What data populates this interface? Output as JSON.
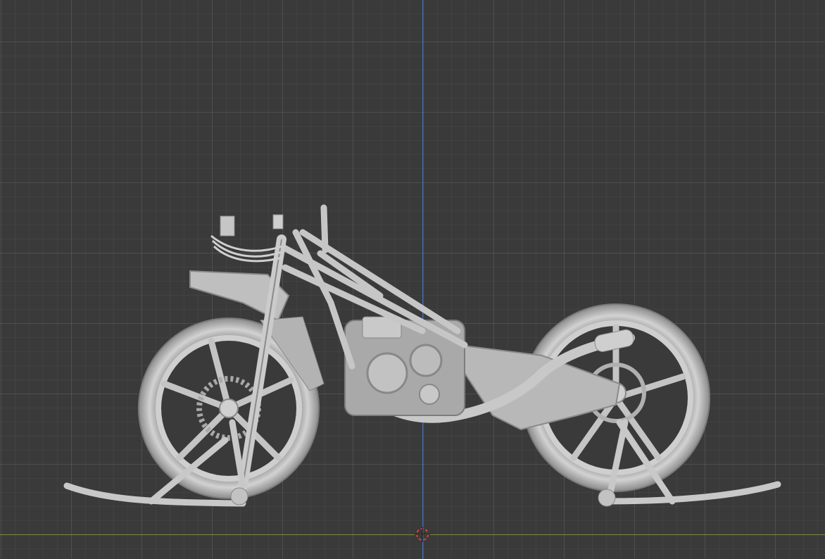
{
  "viewport": {
    "mode": "orthographic-side",
    "object": "motorcycle-model",
    "colors": {
      "background": "#3a3a3a",
      "grid_major": "#4a4a4a",
      "axis_z": "#4a78c8",
      "axis_y": "#8a9a3a",
      "model": "#bdbdbd",
      "cursor_red": "#e04040"
    }
  }
}
